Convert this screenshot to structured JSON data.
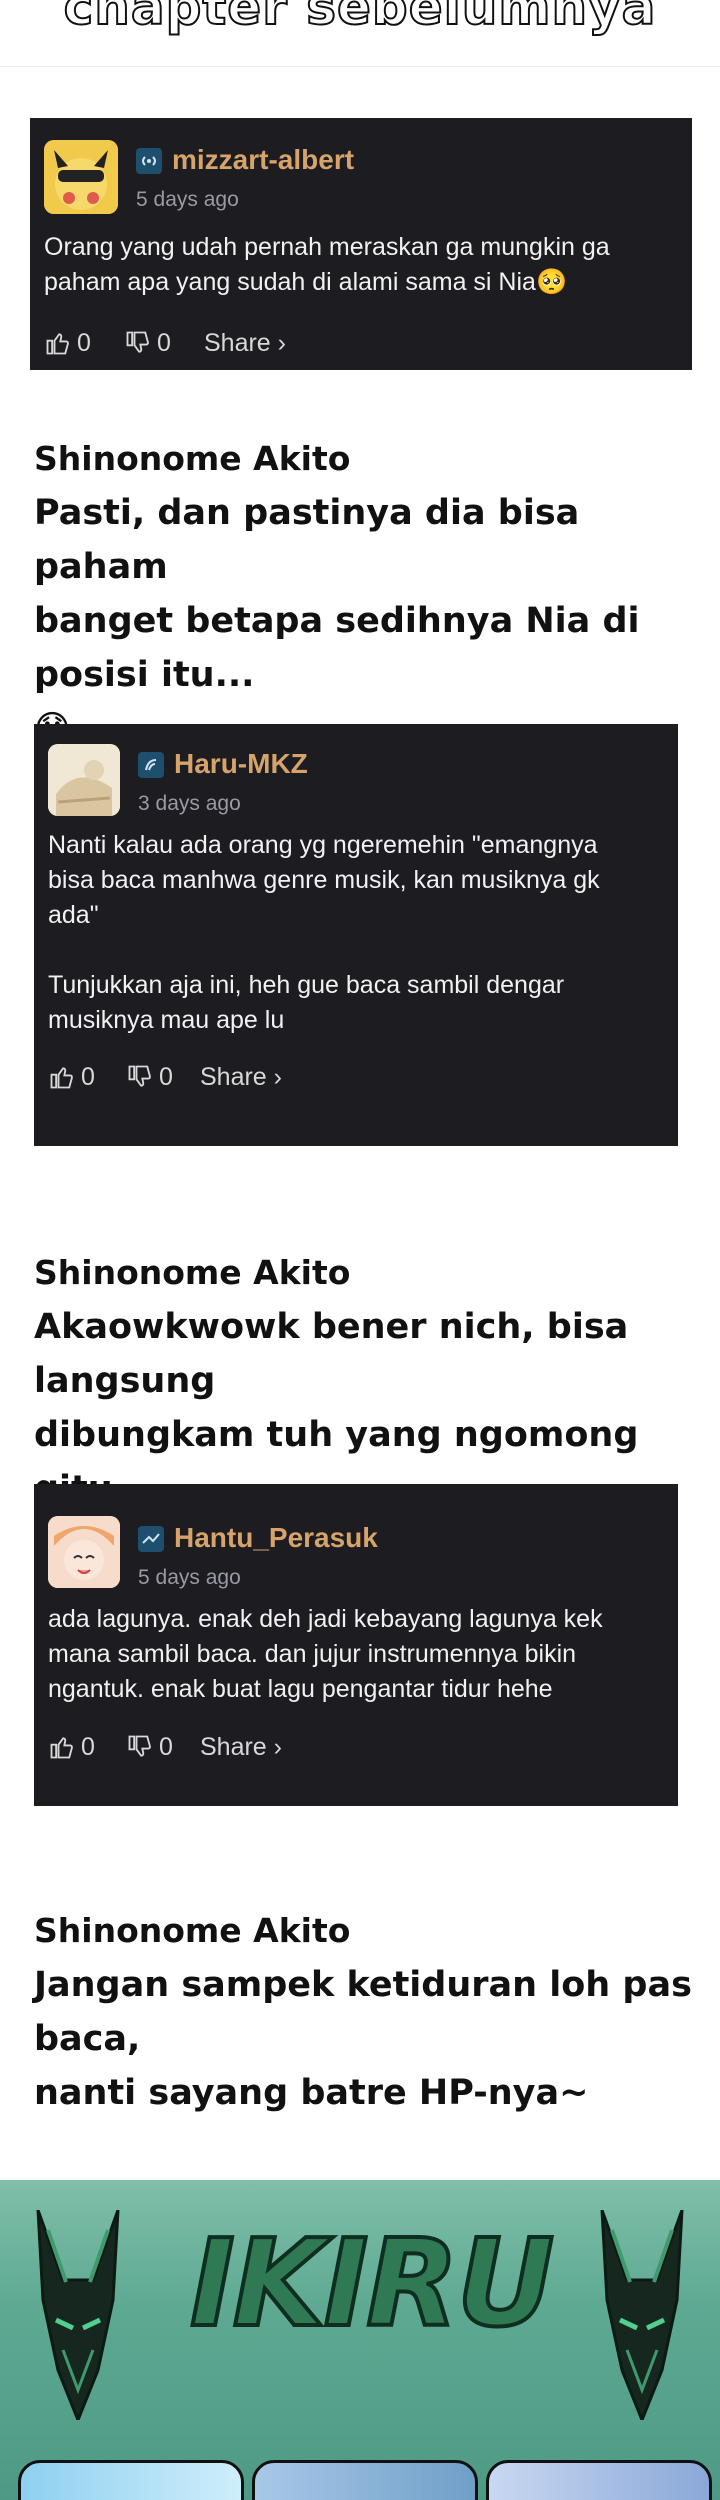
{
  "header": {
    "title": "chapter sebelumnya"
  },
  "comments": [
    {
      "user": "mizzart-albert",
      "time": "5 days ago",
      "text": [
        "Orang yang udah pernah meraskan ga mungkin ga",
        "paham apa yang sudah di alami sama si Nia🥺"
      ],
      "likes": "0",
      "dislikes": "0",
      "share": "Share ›"
    },
    {
      "user": "Haru-MKZ",
      "time": "3 days ago",
      "text": [
        "Nanti kalau ada orang yg ngeremehin \"emangnya",
        "bisa baca manhwa genre musik, kan musiknya gk",
        "ada\"",
        "",
        "Tunjukkan aja ini, heh gue baca sambil dengar",
        "musiknya mau ape lu"
      ],
      "likes": "0",
      "dislikes": "0",
      "share": "Share ›"
    },
    {
      "user": "Hantu_Perasuk",
      "time": "5 days ago",
      "text": [
        "ada lagunya. enak deh jadi kebayang lagunya kek",
        "mana sambil baca. dan jujur instrumennya bikin",
        "ngantuk. enak buat lagu pengantar tidur hehe"
      ],
      "likes": "0",
      "dislikes": "0",
      "share": "Share ›"
    }
  ],
  "replies": [
    {
      "name": "Shinonome Akito",
      "lines": [
        "Pasti, dan pastinya dia bisa paham",
        "banget betapa sedihnya Nia di posisi itu...",
        "😞"
      ]
    },
    {
      "name": "Shinonome Akito",
      "lines": [
        "Akaowkwowk bener nich, bisa langsung",
        "dibungkam tuh yang ngomong gitu"
      ]
    },
    {
      "name": "Shinonome Akito",
      "lines": [
        "Jangan sampek ketiduran loh pas baca,",
        "nanti sayang batre HP-nya~"
      ]
    }
  ],
  "banner": {
    "logo": "IKIRU"
  },
  "colors": {
    "card_bg": "#1c1c21",
    "username": "#d6a36b",
    "banner_green": "#5ea992"
  },
  "icons": [
    "thumbs-up-icon",
    "thumbs-down-icon",
    "badge-icon"
  ]
}
